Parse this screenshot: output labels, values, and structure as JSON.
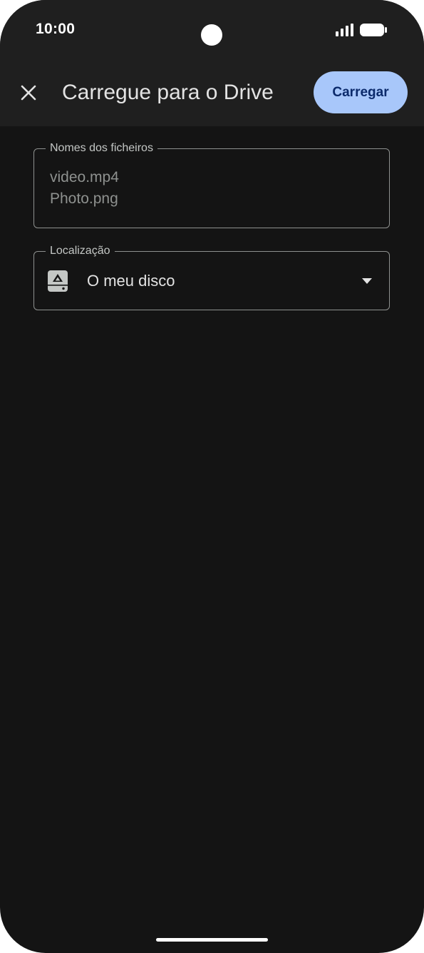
{
  "status_bar": {
    "time": "10:00"
  },
  "app_bar": {
    "close_icon": "close-icon",
    "title": "Carregue para o Drive",
    "upload_label": "Carregar"
  },
  "filenames_field": {
    "label": "Nomes dos ficheiros",
    "files": [
      "video.mp4",
      "Photo.png"
    ]
  },
  "location_field": {
    "label": "Localização",
    "icon": "drive-icon",
    "value": "O meu disco",
    "dropdown_icon": "dropdown-arrow-icon"
  },
  "colors": {
    "background": "#141414",
    "top_surface": "#1f1f1f",
    "primary_button": "#a8c7fa",
    "primary_button_text": "#0b2a6b",
    "outline": "#8e918f"
  }
}
